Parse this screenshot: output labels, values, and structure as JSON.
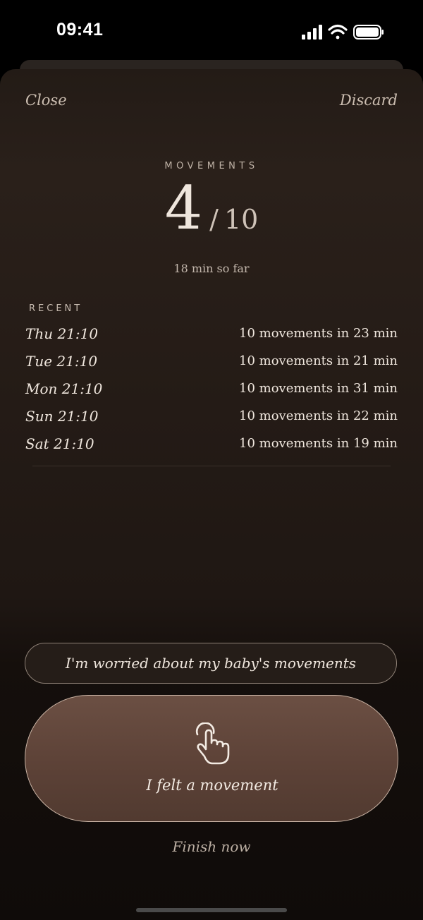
{
  "status_bar": {
    "time": "09:41"
  },
  "header": {
    "close_label": "Close",
    "discard_label": "Discard"
  },
  "counter": {
    "label": "MOVEMENTS",
    "current": "4",
    "separator": "/",
    "total": "10",
    "elapsed": "18 min so far"
  },
  "recent": {
    "label": "RECENT",
    "items": [
      {
        "when": "Thu 21:10",
        "summary": "10 movements in 23 min"
      },
      {
        "when": "Tue 21:10",
        "summary": "10 movements in 21 min"
      },
      {
        "when": "Mon 21:10",
        "summary": "10 movements in 31 min"
      },
      {
        "when": "Sun 21:10",
        "summary": "10 movements in 22 min"
      },
      {
        "when": "Sat 21:10",
        "summary": "10 movements in 19 min"
      }
    ]
  },
  "actions": {
    "worried_label": "I'm worried about my baby's movements",
    "felt_label": "I felt a movement",
    "felt_icon": "tap-hand-icon",
    "finish_label": "Finish now"
  },
  "colors": {
    "accent_button": "#5e4338",
    "text_primary": "#efe6dd"
  }
}
